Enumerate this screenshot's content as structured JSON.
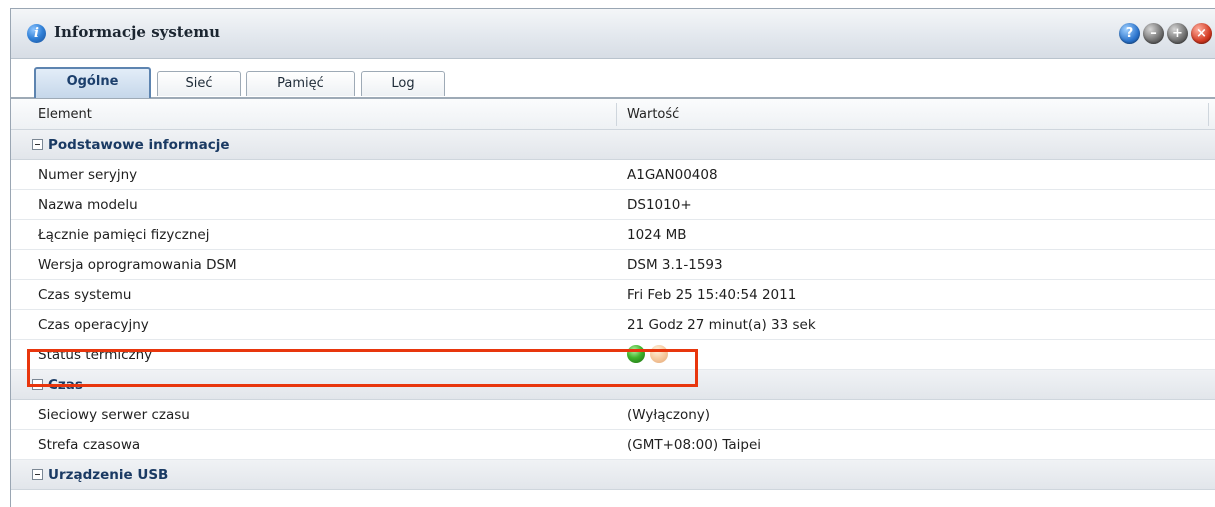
{
  "window": {
    "title": "Informacje systemu",
    "buttons": [
      "help-icon",
      "minimize-icon",
      "maximize-icon",
      "close-icon"
    ]
  },
  "tabs": [
    {
      "label": "Ogólne",
      "active": true
    },
    {
      "label": "Sieć",
      "active": false
    },
    {
      "label": "Pamięć",
      "active": false
    },
    {
      "label": "Log",
      "active": false
    }
  ],
  "grid": {
    "headers": {
      "element": "Element",
      "value": "Wartość"
    },
    "groups": [
      {
        "title": "Podstawowe informacje",
        "rows": [
          {
            "label": "Numer seryjny",
            "value": "A1GAN00408"
          },
          {
            "label": "Nazwa modelu",
            "value": "DS1010+"
          },
          {
            "label": "Łącznie pamięci fizycznej",
            "value": "1024 MB"
          },
          {
            "label": "Wersja oprogramowania DSM",
            "value": "DSM 3.1-1593"
          },
          {
            "label": "Czas systemu",
            "value": "Fri Feb 25 15:40:54 2011"
          },
          {
            "label": "Czas operacyjny",
            "value": "21 Godz 27 minut(a) 33 sek"
          },
          {
            "label": "Status termiczny",
            "value": "",
            "indicator": [
              "green-led-icon",
              "amber-led-icon"
            ]
          }
        ]
      },
      {
        "title": "Czas",
        "rows": [
          {
            "label": "Sieciowy serwer czasu",
            "value": "(Wyłączony)"
          },
          {
            "label": "Strefa czasowa",
            "value": "(GMT+08:00) Taipei"
          }
        ]
      },
      {
        "title": "Urządzenie USB",
        "rows": []
      }
    ]
  },
  "colors": {
    "highlight": "#e8360d",
    "group_text": "#1a3a63",
    "thermal_ok": "#41b52c",
    "thermal_warn": "#f6caa0"
  }
}
